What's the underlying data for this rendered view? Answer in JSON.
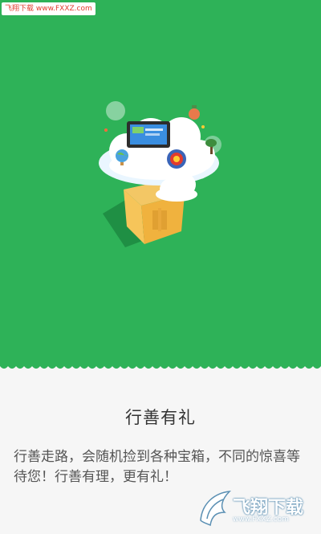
{
  "watermark_top": "飞翔下载 www.FXXZ.com",
  "intro": {
    "title": "行善有礼",
    "description": "行善走路，会随机捡到各种宝箱，不同的惊喜等待您！行善有理，更有礼！"
  },
  "watermark_bottom": {
    "name": "飞翔下载",
    "url": "www.FXXZ.com"
  },
  "colors": {
    "hero_bg": "#2eb258",
    "page_bg": "#f6f6f6"
  },
  "illustration_icons": [
    "cloud-icon",
    "tablet-icon",
    "gift-box-icon",
    "globe-icon",
    "lucky-badge-icon",
    "plant-icon",
    "bubble-icon"
  ]
}
